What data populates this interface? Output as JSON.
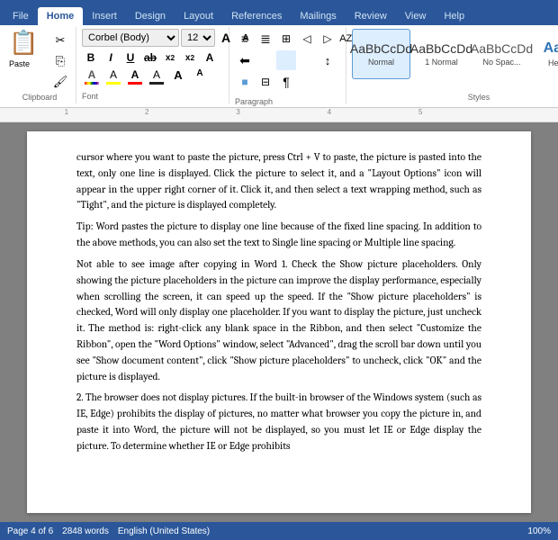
{
  "tabs": {
    "items": [
      "File",
      "Home",
      "Insert",
      "Design",
      "Layout",
      "References",
      "Mailings",
      "Review",
      "View",
      "Help"
    ],
    "active": "Home"
  },
  "ribbon": {
    "clipboard": {
      "paste_label": "Paste",
      "cut_label": "✂",
      "copy_label": "⎘",
      "format_label": "🖌"
    },
    "font": {
      "family": "Corbel (Body)",
      "size": "12",
      "bold": "B",
      "italic": "I",
      "underline": "U",
      "strikethrough": "ab",
      "subscript": "x₂",
      "superscript": "x²",
      "clear_fmt": "A",
      "grow": "A",
      "shrink": "A",
      "font_color_label": "A",
      "highlight_label": "A",
      "text_color_label": "A"
    },
    "paragraph": {
      "bullets": "≡",
      "numbering": "≣",
      "decrease": "◁",
      "increase": "▷",
      "align_left": "≡",
      "align_center": "≡",
      "align_right": "≡",
      "justify": "≡",
      "line_spacing": "↕",
      "shading": "■",
      "border": "⊞",
      "pilcrow": "¶"
    },
    "styles": {
      "items": [
        {
          "label": "Normal",
          "class": "normal",
          "active": true
        },
        {
          "label": "1 Normal",
          "class": "normal",
          "active": false
        },
        {
          "label": "No Spac...",
          "class": "nospace",
          "active": false
        },
        {
          "label": "Headi...",
          "class": "heading",
          "active": false
        }
      ]
    },
    "groups": {
      "clipboard_label": "Clipboard",
      "font_label": "Font",
      "paragraph_label": "Paragraph",
      "styles_label": "Styles"
    }
  },
  "ruler": {
    "marks": [
      "1",
      "2",
      "3",
      "4",
      "5"
    ]
  },
  "document": {
    "paragraphs": [
      "cursor where you want to paste the picture, press Ctrl + V to paste, the picture is pasted into the text, only one line is displayed. Click the picture to select it, and a \"Layout Options\" icon will appear in the upper right corner of it. Click it, and then select a text wrapping method, such as \"Tight\", and the picture is displayed completely.",
      "Tip: Word pastes the picture to display one line because of the fixed line spacing. In addition to the above methods, you can also set the text to Single line spacing or Multiple                           line                          spacing.",
      "Not    able    to    see    image    after    copying    in    Word 1. Check the Show picture placeholders. Only showing the picture placeholders in the picture can improve the display performance, especially when scrolling the screen, it can speed up the speed. If the \"Show picture placeholders\" is checked, Word will only display one placeholder. If you want to display the picture, just uncheck it. The method is: right-click any blank space in the Ribbon, and then select \"Customize the Ribbon\", open the \"Word Options\" window, select \"Advanced\", drag the scroll bar down until you see \"Show document content\", click \"Show picture placeholders\" to uncheck,    click    \"OK\"    and    the    picture    is    displayed.",
      "2. The browser does not display pictures. If the built-in browser of the Windows system (such as IE, Edge) prohibits the display of pictures, no matter what browser you copy the picture in, and paste it into Word, the picture will not be displayed, so you must let IE or Edge display the picture. To determine whether IE or Edge prohibits"
    ]
  },
  "status": {
    "page": "Page 4 of 6",
    "words": "2848 words",
    "language": "English (United States)",
    "zoom": "100%"
  }
}
